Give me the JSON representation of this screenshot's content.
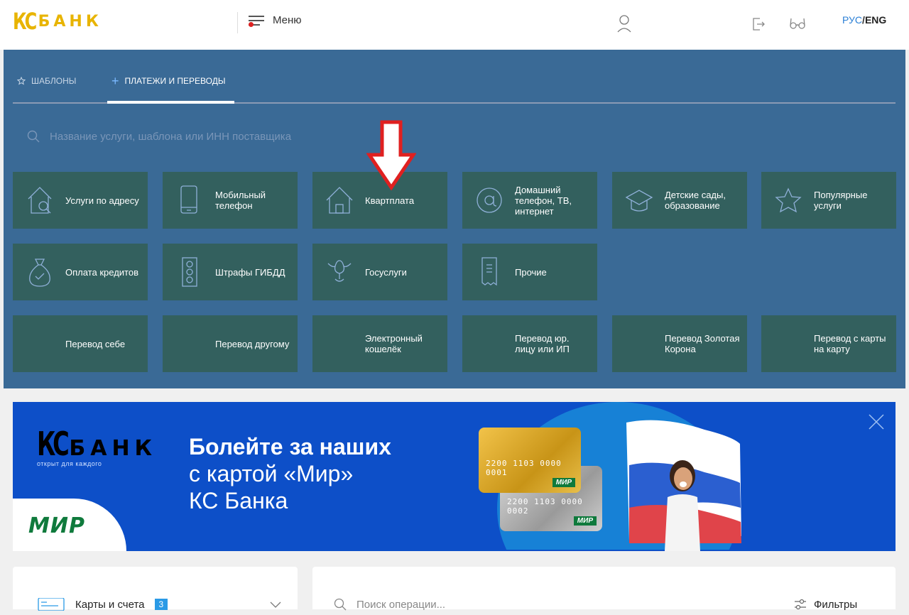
{
  "header": {
    "logo_kc": "КС",
    "logo_bank": "БАНК",
    "menu_label": "Меню",
    "lang_ru": "РУС",
    "lang_sep": "/",
    "lang_en": "ENG"
  },
  "payments": {
    "tabs": [
      {
        "label": "ШАБЛОНЫ",
        "icon": "star-icon"
      },
      {
        "label": "ПЛАТЕЖИ И ПЕРЕВОДЫ",
        "icon": "plus-icon"
      }
    ],
    "search_placeholder": "Название услуги, шаблона или ИНН поставщика",
    "tiles_row1": [
      {
        "label": "Услуги по адресу",
        "icon": "house-search-icon"
      },
      {
        "label": "Мобильный телефон",
        "icon": "phone-icon"
      },
      {
        "label": "Квартплата",
        "icon": "house-icon"
      },
      {
        "label": "Домашний телефон, ТВ, интернет",
        "icon": "at-icon"
      },
      {
        "label": "Детские сады, образование",
        "icon": "graduation-cap-icon"
      },
      {
        "label": "Популярные услуги",
        "icon": "star-icon"
      }
    ],
    "tiles_row2": [
      {
        "label": "Оплата кредитов",
        "icon": "money-bag-icon"
      },
      {
        "label": "Штрафы ГИБДД",
        "icon": "traffic-light-icon"
      },
      {
        "label": "Госуслуги",
        "icon": "eagle-icon"
      },
      {
        "label": "Прочие",
        "icon": "receipt-icon"
      }
    ],
    "tiles_row3": [
      {
        "label": "Перевод себе",
        "icon": "user-icon"
      },
      {
        "label": "Перевод другому",
        "icon": "user-transfer-icon"
      },
      {
        "label": "Электронный кошелёк",
        "icon": "wallet-icon"
      },
      {
        "label": "Перевод юр. лицу или ИП",
        "icon": "briefcase-icon"
      },
      {
        "label": "Перевод Золотая Корона",
        "icon": "crown-icon"
      },
      {
        "label": "Перевод с карты на карту",
        "icon": "card-transfer-icon"
      }
    ]
  },
  "banner": {
    "logo_kc": "КС",
    "logo_bank": "БАНК",
    "tagline": "открыт для каждого",
    "mir": "МИР",
    "line1": "Болейте за наших",
    "line2": "с картой «Мир»",
    "line3": "КС Банка",
    "card1_number": "2200 1103 0000 0001",
    "card2_number": "2200 1103 0000 0002",
    "card_mir": "МИР"
  },
  "cards_section": {
    "title": "Карты и счета",
    "count": "3"
  },
  "operations": {
    "search_placeholder": "Поиск операции...",
    "filters_label": "Фильтры"
  },
  "colors": {
    "panel": "#3a6a96",
    "tile": "#33605e",
    "accent_blue": "#2a7fd6",
    "banner": "#0d4fc8",
    "gold": "#e8b400",
    "green_icon": "#3fcf6f"
  }
}
